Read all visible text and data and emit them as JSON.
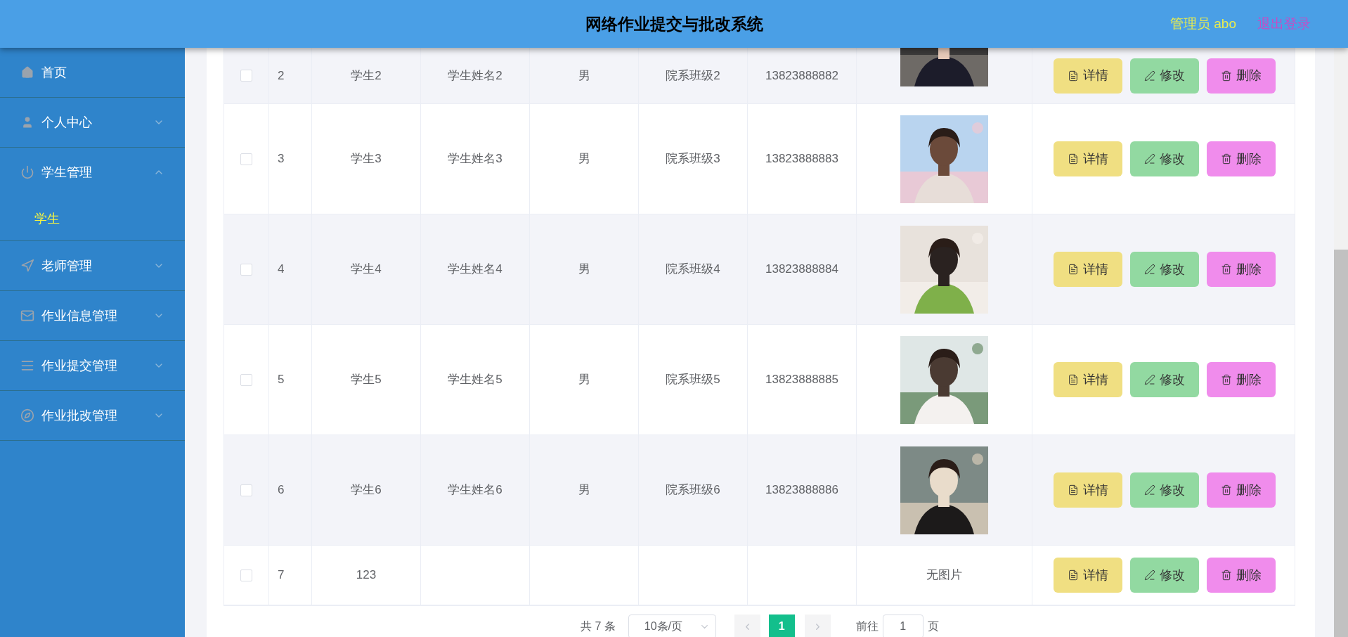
{
  "header": {
    "title": "网络作业提交与批改系统",
    "user": "管理员 abo",
    "logout": "退出登录"
  },
  "sidebar": {
    "items": [
      {
        "label": "首页",
        "kind": "link"
      },
      {
        "label": "个人中心",
        "kind": "menu",
        "expanded": false
      },
      {
        "label": "学生管理",
        "kind": "menu",
        "expanded": true,
        "children": [
          {
            "label": "学生",
            "selected": true
          }
        ]
      },
      {
        "label": "老师管理",
        "kind": "menu",
        "expanded": false
      },
      {
        "label": "作业信息管理",
        "kind": "menu",
        "expanded": false
      },
      {
        "label": "作业提交管理",
        "kind": "menu",
        "expanded": false
      },
      {
        "label": "作业批改管理",
        "kind": "menu",
        "expanded": false
      }
    ]
  },
  "table": {
    "rows": [
      {
        "checked": false,
        "index": "2",
        "student_no": "学生2",
        "name": "学生姓名2",
        "gender": "男",
        "class": "院系班级2",
        "phone": "13823888882",
        "actions": [
          {
            "kind": "detail",
            "label": "详情"
          },
          {
            "kind": "edit",
            "label": "修改"
          },
          {
            "kind": "delete",
            "label": "删除"
          }
        ]
      },
      {
        "checked": false,
        "index": "3",
        "student_no": "学生3",
        "name": "学生姓名3",
        "gender": "男",
        "class": "院系班级3",
        "phone": "13823888883",
        "actions": [
          {
            "kind": "detail",
            "label": "详情"
          },
          {
            "kind": "edit",
            "label": "修改"
          },
          {
            "kind": "delete",
            "label": "删除"
          }
        ]
      },
      {
        "checked": false,
        "index": "4",
        "student_no": "学生4",
        "name": "学生姓名4",
        "gender": "男",
        "class": "院系班级4",
        "phone": "13823888884",
        "actions": [
          {
            "kind": "detail",
            "label": "详情"
          },
          {
            "kind": "edit",
            "label": "修改"
          },
          {
            "kind": "delete",
            "label": "删除"
          }
        ]
      },
      {
        "checked": false,
        "index": "5",
        "student_no": "学生5",
        "name": "学生姓名5",
        "gender": "男",
        "class": "院系班级5",
        "phone": "13823888885",
        "actions": [
          {
            "kind": "detail",
            "label": "详情"
          },
          {
            "kind": "edit",
            "label": "修改"
          },
          {
            "kind": "delete",
            "label": "删除"
          }
        ]
      },
      {
        "checked": false,
        "index": "6",
        "student_no": "学生6",
        "name": "学生姓名6",
        "gender": "男",
        "class": "院系班级6",
        "phone": "13823888886",
        "actions": [
          {
            "kind": "detail",
            "label": "详情"
          },
          {
            "kind": "edit",
            "label": "修改"
          },
          {
            "kind": "delete",
            "label": "删除"
          }
        ]
      },
      {
        "checked": false,
        "index": "7",
        "student_no": "123",
        "photo": {
          "kind": "text",
          "text": "无图片"
        },
        "actions": [
          {
            "kind": "detail",
            "label": "详情"
          },
          {
            "kind": "edit",
            "label": "修改"
          },
          {
            "kind": "delete",
            "label": "删除"
          }
        ]
      }
    ]
  },
  "pagination": {
    "total": "共 7 条",
    "page_size": "10条/页",
    "pages": [
      {
        "label": "1",
        "selected": true
      }
    ],
    "goto_label": "前往",
    "goto_value": "1",
    "goto_suffix": "页"
  }
}
